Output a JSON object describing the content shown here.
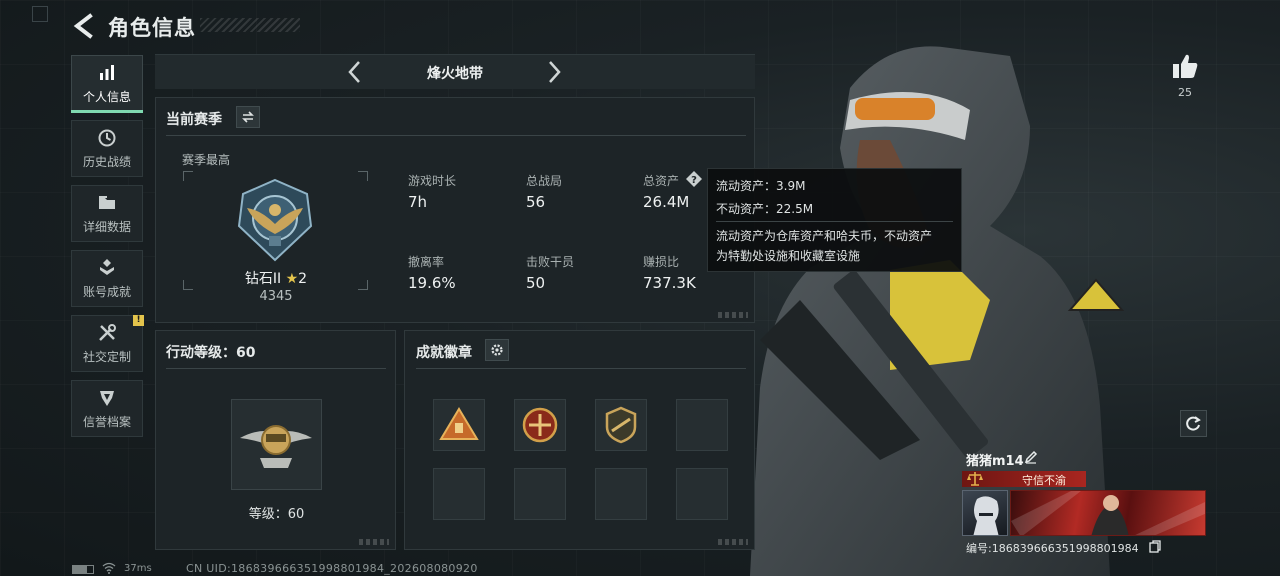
{
  "header": {
    "title": "角色信息"
  },
  "sidebar": {
    "items": [
      {
        "label": "个人信息",
        "icon": "bar-chart-icon",
        "active": true
      },
      {
        "label": "历史战绩",
        "icon": "history-clock-icon"
      },
      {
        "label": "详细数据",
        "icon": "folder-icon"
      },
      {
        "label": "账号成就",
        "icon": "achievement-icon"
      },
      {
        "label": "社交定制",
        "icon": "tools-icon",
        "badge": "!"
      },
      {
        "label": "信誉档案",
        "icon": "reputation-icon"
      }
    ]
  },
  "mode": {
    "label": "烽火地带"
  },
  "season": {
    "title": "当前赛季",
    "best_label": "赛季最高",
    "rank_name": "钻石II",
    "rank_stars": "2",
    "rank_points": "4345",
    "stats": [
      {
        "label": "游戏时长",
        "value": "7h"
      },
      {
        "label": "总战局",
        "value": "56"
      },
      {
        "label": "总资产",
        "value": "26.4M"
      },
      {
        "label": "撤离率",
        "value": "19.6%"
      },
      {
        "label": "击败干员",
        "value": "50"
      },
      {
        "label": "赚损比",
        "value": "737.3K"
      }
    ]
  },
  "tooltip": {
    "liquid": "流动资产：3.9M",
    "fixed": "不动资产：22.5M",
    "note_line1": "流动资产为仓库资产和哈夫币，不动资产",
    "note_line2": "为特勤处设施和收藏室设施"
  },
  "action_level": {
    "title": "行动等级：60",
    "level_text": "等级：60"
  },
  "badges": {
    "title": "成就徽章"
  },
  "likes": {
    "count": "25"
  },
  "player": {
    "name": "猪猪m14",
    "honor": "守信不渝",
    "serial": "编号:186839666351998801984"
  },
  "status": {
    "ping": "37ms",
    "uid": "CN UID:186839666351998801984_202608080920"
  },
  "colors": {
    "accent": "#7fd9b0",
    "gold": "#e3c44c",
    "honor_red": "#a82620"
  }
}
